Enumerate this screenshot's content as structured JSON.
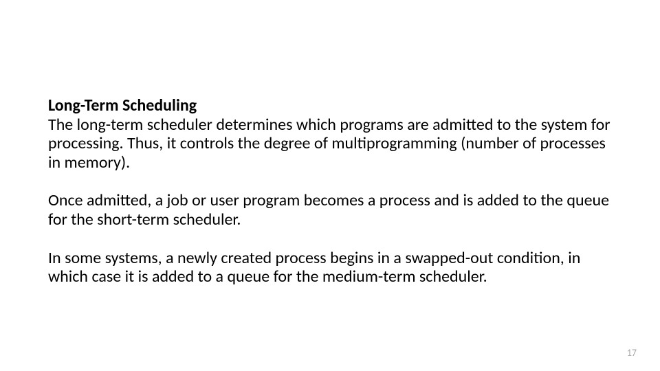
{
  "slide": {
    "heading": "Long-Term Scheduling",
    "p1": "The long-term scheduler determines which programs are admitted to the system for processing. Thus, it controls the degree of multiprogramming (number of processes in memory).",
    "p2": "Once admitted, a job or user program becomes a process and is added to the queue for the short-term scheduler.",
    "p3": "In some systems, a newly created process begins in a swapped-out condition, in which case it is added to a queue for the medium-term scheduler.",
    "page_number": "17"
  }
}
